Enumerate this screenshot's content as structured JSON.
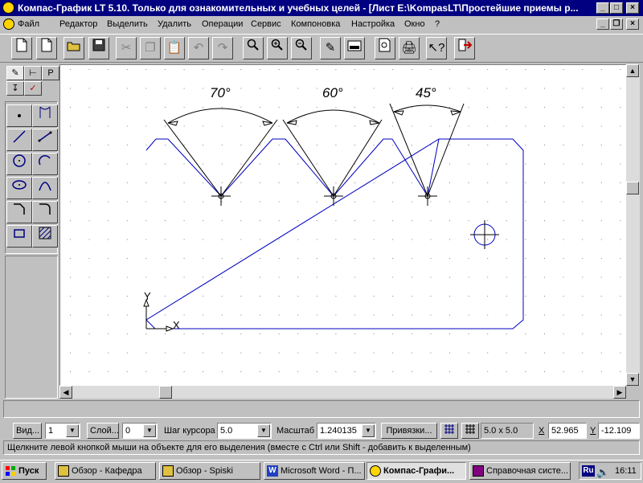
{
  "window": {
    "title": "Компас-График LT 5.10. Только для ознакомительных и учебных целей - [Лист E:\\KompasLT\\Простейшие приемы р...",
    "controls": {
      "minimize": "_",
      "maximize": "□",
      "close": "×"
    }
  },
  "menu": {
    "items": [
      "Файл",
      "Редактор",
      "Выделить",
      "Удалить",
      "Операции",
      "Сервис",
      "Компоновка",
      "Настройка",
      "Окно",
      "?"
    ],
    "doc_controls": {
      "minimize": "_",
      "restore": "❐",
      "close": "×"
    }
  },
  "toolbar": {
    "icons": [
      "new-sheet-icon",
      "new-fragment-icon",
      "open-icon",
      "save-icon",
      "cut-icon",
      "copy-icon",
      "paste-icon",
      "undo-icon",
      "redo-icon",
      "zoom-window-icon",
      "zoom-in-icon",
      "zoom-out-icon",
      "pan-icon",
      "show-all-icon",
      "print-preview-icon",
      "print-icon",
      "help-pointer-icon",
      "exit-icon"
    ]
  },
  "palette": {
    "tabs": [
      "✎",
      "⊢",
      "P"
    ],
    "tools": [
      "point",
      "auxiliary-line",
      "segment",
      "polyline",
      "circle",
      "arc",
      "ellipse",
      "spline",
      "chamfer",
      "fillet",
      "rectangle",
      "hatch"
    ]
  },
  "drawing": {
    "angles": [
      "70°",
      "60°",
      "45°"
    ],
    "axis_x": "X",
    "axis_y": "Y",
    "colors": {
      "geometry": "#0000c0",
      "dim": "#000000",
      "grid": "#808080"
    }
  },
  "params": {
    "view_button": "Вид...",
    "view_value": "1",
    "layer_button": "Слой...",
    "layer_value": "0",
    "step_label": "Шаг курсора",
    "step_value": "5.0",
    "scale_label": "Масштаб",
    "scale_value": "1.240135",
    "snaps_button": "Привязки...",
    "grid_value": "5.0 x 5.0",
    "x_label": "X",
    "x_value": "52.965",
    "y_label": "Y",
    "y_value": "-12.109"
  },
  "status": "Щелкните левой кнопкой мыши на объекте для его выделения (вместе с Ctrl или Shift - добавить к выделенным)",
  "taskbar": {
    "start": "Пуск",
    "tasks": [
      "Обзор - Кафедра",
      "Обзор - Spiski",
      "Microsoft Word - П...",
      "Компас-Графи...",
      "Справочная систе..."
    ],
    "lang": "Ru",
    "time": "16:11"
  }
}
